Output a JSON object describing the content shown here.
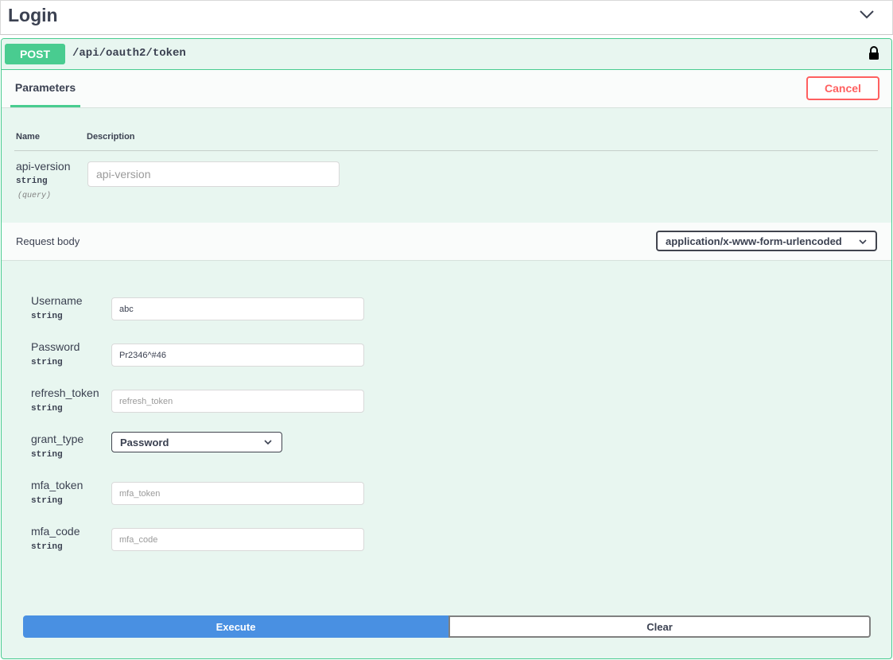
{
  "section": {
    "title": "Login"
  },
  "operation": {
    "method": "POST",
    "path": "/api/oauth2/token"
  },
  "tabs": {
    "parameters_label": "Parameters",
    "cancel_label": "Cancel"
  },
  "parameters": {
    "columns": {
      "name": "Name",
      "description": "Description"
    },
    "items": [
      {
        "name": "api-version",
        "type": "string",
        "in": "(query)",
        "placeholder": "api-version",
        "value": ""
      }
    ]
  },
  "request_body": {
    "label": "Request body",
    "content_type": "application/x-www-form-urlencoded",
    "fields": [
      {
        "name": "Username",
        "type": "string",
        "value": "abc",
        "placeholder": ""
      },
      {
        "name": "Password",
        "type": "string",
        "value": "Pr2346^#46",
        "placeholder": ""
      },
      {
        "name": "refresh_token",
        "type": "string",
        "value": "",
        "placeholder": "refresh_token"
      },
      {
        "name": "grant_type",
        "type": "string",
        "selected": "Password"
      },
      {
        "name": "mfa_token",
        "type": "string",
        "value": "",
        "placeholder": "mfa_token"
      },
      {
        "name": "mfa_code",
        "type": "string",
        "value": "",
        "placeholder": "mfa_code"
      }
    ]
  },
  "actions": {
    "execute_label": "Execute",
    "clear_label": "Clear"
  },
  "colors": {
    "post_green": "#49cc90",
    "panel_bg": "#e8f6f0",
    "cancel_red": "#ff6060",
    "execute_blue": "#4990e2"
  },
  "icons": {
    "section_toggle": "chevron-down-icon",
    "auth": "lock-icon",
    "select_arrow": "chevron-down-icon"
  }
}
